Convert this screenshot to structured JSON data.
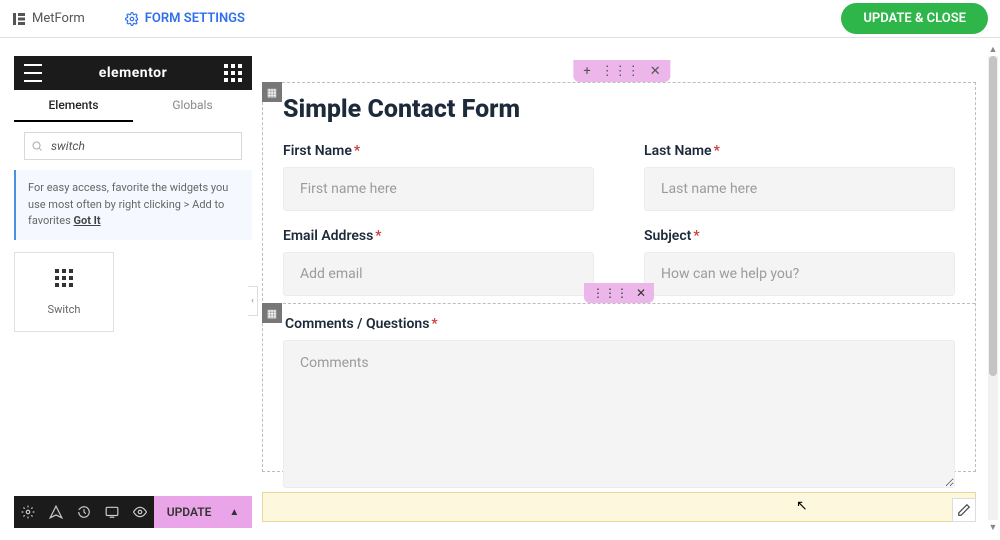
{
  "topbar": {
    "brand": "MetForm",
    "form_settings": "FORM SETTINGS",
    "update_close": "UPDATE & CLOSE"
  },
  "panel": {
    "logo": "elementor",
    "tabs": {
      "elements": "Elements",
      "globals": "Globals"
    },
    "search_value": "switch",
    "tip_text": "For easy access, favorite the widgets you use most often by right clicking > Add to favorites ",
    "tip_gotit": "Got It",
    "widget_label": "Switch"
  },
  "bottombar": {
    "update": "UPDATE"
  },
  "form": {
    "title": "Simple Contact Form",
    "fields": {
      "first_name": {
        "label": "First Name",
        "placeholder": "First name here"
      },
      "last_name": {
        "label": "Last Name",
        "placeholder": "Last name here"
      },
      "email": {
        "label": "Email Address",
        "placeholder": "Add email"
      },
      "subject": {
        "label": "Subject",
        "placeholder": "How can we help you?"
      },
      "comments": {
        "label": "Comments / Questions",
        "placeholder": "Comments"
      }
    }
  },
  "colors": {
    "accent_green": "#2fb64a",
    "accent_pink": "#ecb6ea",
    "accent_blue": "#2f6fed"
  }
}
